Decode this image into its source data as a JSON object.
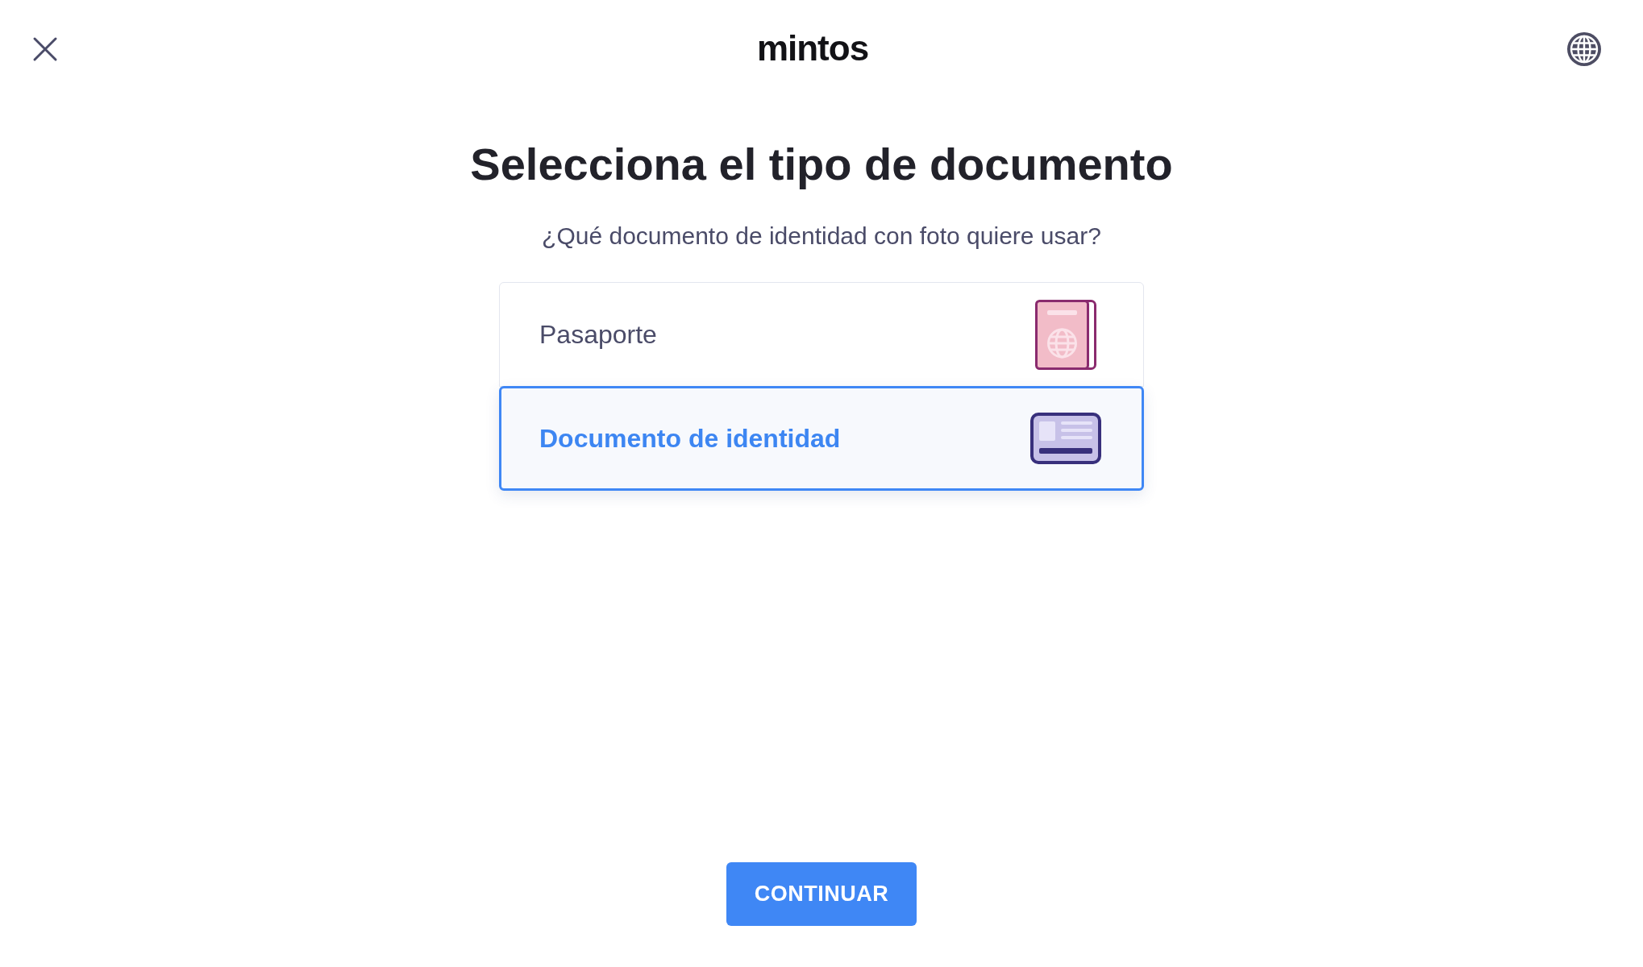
{
  "header": {
    "logo": "mintos"
  },
  "title": "Selecciona el tipo de documento",
  "subtitle": "¿Qué documento de identidad con foto quiere usar?",
  "options": [
    {
      "label": "Pasaporte",
      "kind": "passport",
      "selected": false
    },
    {
      "label": "Documento de identidad",
      "kind": "id_card",
      "selected": true
    }
  ],
  "continue_button": {
    "label": "CONTINUAR"
  }
}
